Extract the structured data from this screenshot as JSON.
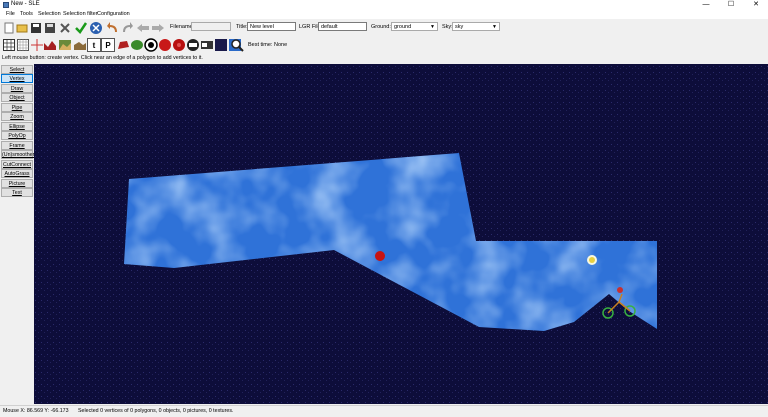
{
  "window": {
    "title": "New - SLE",
    "minimize": "—",
    "maximize": "☐",
    "close": "✕"
  },
  "menu": [
    "File",
    "Tools",
    "Selection",
    "Selection filter",
    "Configuration"
  ],
  "fields": {
    "filename_label": "Filename:",
    "filename_value": "",
    "title_label": "Title:",
    "title_value": "New level",
    "lgr_label": "LGR File:",
    "lgr_value": "default",
    "ground_label": "Ground:",
    "ground_value": "ground",
    "sky_label": "Sky:",
    "sky_value": "sky"
  },
  "best_time": "Best time: None",
  "hint": "Left mouse button: create vertex. Click near an edge of a polygon to add vertices to it.",
  "tools": [
    "Select",
    "Vertex",
    "Draw",
    "Object",
    "Pipe",
    "Zoom",
    "Ellipse",
    "PolyOp",
    "Frame",
    "(Un)smoothen",
    "CutConnect",
    "AutoGrass",
    "Picture",
    "Text"
  ],
  "active_tool": "Vertex",
  "status": {
    "mouse": "Mouse X: 86.569 Y: -66.173",
    "selection": "Selected 0 vertices of 0 polygons, 0 objects, 0 pictures, 0 textures."
  },
  "icons": {
    "toolbar_row1": [
      "new-file-icon",
      "open-folder-icon",
      "save-icon",
      "save-as-icon",
      "delete-icon",
      "check-icon",
      "stop-icon",
      "undo-icon",
      "redo-icon",
      "back-arrow-icon",
      "forward-arrow-icon"
    ],
    "toolbar_row2": [
      "grid-icon",
      "grid-small-icon",
      "ruler-icon",
      "ground-texture-icon",
      "sky-texture-icon",
      "hill-icon",
      "text-t-icon",
      "picture-p-icon",
      "apple-red-icon",
      "bush-icon",
      "killer-icon",
      "flower-icon",
      "red-apple-icon",
      "red-circle-icon",
      "bar-icon",
      "dark-texture-icon",
      "blue-square-icon",
      "magnifier-icon"
    ]
  },
  "colors": {
    "canvas": "#0d0d3a",
    "water": "#3d7ee0",
    "apple": "#cc1111",
    "flower": "#ffffff",
    "active_tool": "#cce4f7"
  }
}
